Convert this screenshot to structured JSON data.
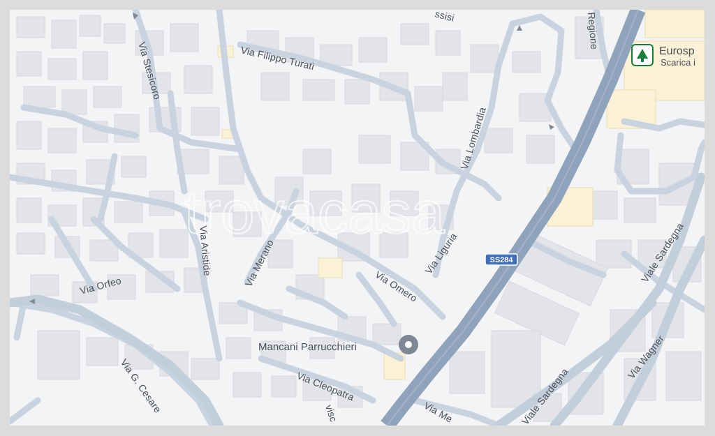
{
  "watermark": "trovacasa",
  "route_shield": "SS284",
  "poi": {
    "name": "Mancani Parrucchieri",
    "icon": "location-pin-icon"
  },
  "store": {
    "name": "Eurosp",
    "subtitle": "Scarica i",
    "icon": "supermarket-icon",
    "brand_color": "#1a7f3c"
  },
  "streets": [
    "Via Filippo Turati",
    "Via Stesicoro",
    "Via Lombardia",
    "Regione",
    "Via Aristide",
    "Via Merano",
    "Via Liguria",
    "Via Orfeo",
    "Via Omero",
    "Viale Sardegna",
    "Via Wagner",
    "Via G. Cesare",
    "Via Cleopatra",
    "Viale Sardegna",
    "Via Me",
    "ssisi",
    "visc"
  ],
  "colors": {
    "background": "#f3f4f6",
    "building": "#e2e4e9",
    "road": "#c9d3df",
    "highway": "#8fa3bb",
    "highlight_building": "#fbf1d6"
  }
}
